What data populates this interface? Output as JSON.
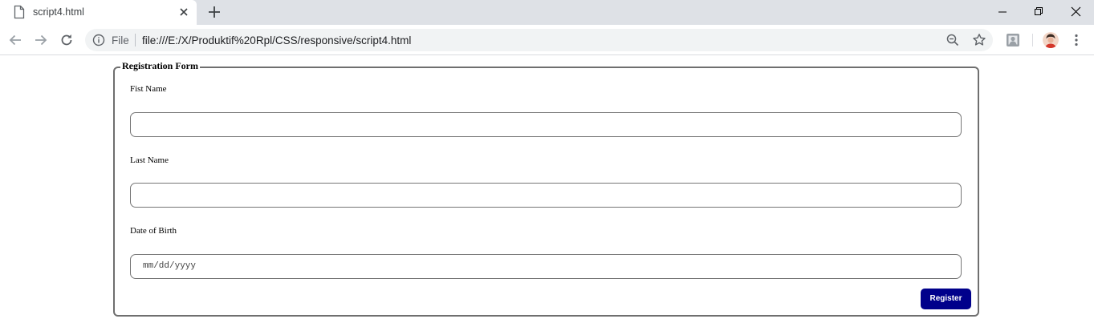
{
  "browser": {
    "tab_title": "script4.html",
    "address_scheme_label": "File",
    "url": "file:///E:/X/Produktif%20Rpl/CSS/responsive/script4.html"
  },
  "icons": {
    "tab_page": "page-icon",
    "tab_close": "close-icon",
    "new_tab": "plus-icon",
    "back": "back-arrow-icon",
    "forward": "forward-arrow-icon",
    "reload": "reload-icon",
    "info": "info-icon",
    "zoom": "zoom-out-icon",
    "bookmark": "star-icon",
    "extension": "extension-icon",
    "profile": "avatar",
    "menu": "kebab-menu-icon"
  },
  "form": {
    "legend": "Registration Form",
    "fields": [
      {
        "label": "Fist Name",
        "value": ""
      },
      {
        "label": "Last Name",
        "value": ""
      },
      {
        "label": "Date of Birth",
        "placeholder": "mm/dd/yyyy"
      }
    ],
    "submit_label": "Register"
  },
  "colors": {
    "submit_bg": "#00008b",
    "tabstrip_bg": "#dee1e6",
    "omnibox_bg": "#f1f3f4"
  }
}
